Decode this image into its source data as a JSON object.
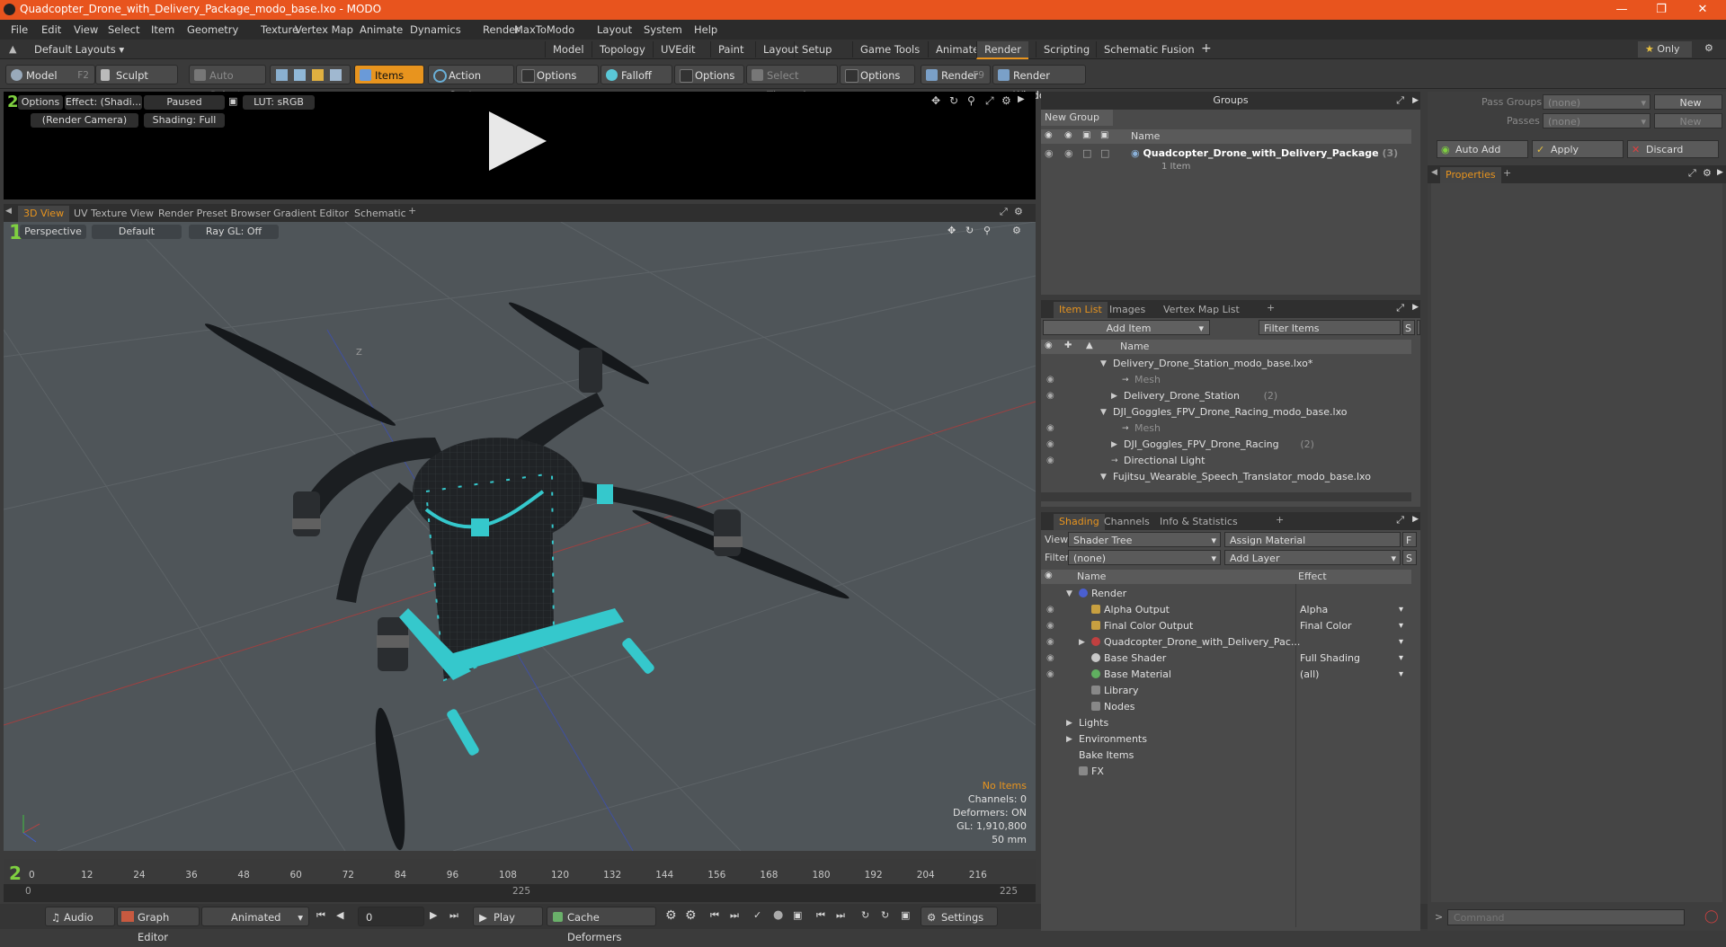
{
  "window": {
    "title": "Quadcopter_Drone_with_Delivery_Package_modo_base.lxo - MODO"
  },
  "menu": [
    "File",
    "Edit",
    "View",
    "Select",
    "Item",
    "Geometry",
    "Texture",
    "Vertex Map",
    "Animate",
    "Dynamics",
    "Render",
    "MaxToModo",
    "Layout",
    "System",
    "Help"
  ],
  "layoutbar": {
    "preset": "Default Layouts",
    "tabs": [
      "Model",
      "Topology",
      "UVEdit",
      "Paint",
      "Layout",
      "Setup",
      "Game Tools",
      "Animate",
      "Render",
      "Scripting",
      "Schematic Fusion"
    ],
    "active": "Render",
    "only": "Only"
  },
  "toolbar": {
    "model": "Model",
    "model_key": "F2",
    "sculpt": "Sculpt",
    "auto_select": "Auto Select",
    "items": "Items",
    "action_center": "Action Center",
    "options1": "Options",
    "falloff": "Falloff",
    "options2": "Options",
    "select_through": "Select Through",
    "options3": "Options",
    "render": "Render",
    "render_key": "F9",
    "render_window": "Render Window"
  },
  "preview": {
    "options": "Options",
    "effect": "Effect: (Shadi...",
    "paused": "Paused",
    "lut": "LUT: sRGB",
    "camera": "(Render Camera)",
    "shading": "Shading: Full"
  },
  "viewport_tabs": [
    "3D View",
    "UV Texture View",
    "Render Preset Browser",
    "Gradient Editor",
    "Schematic"
  ],
  "viewport": {
    "perspective": "Perspective",
    "default": "Default",
    "raygl": "Ray GL: Off",
    "axis_label": "Z",
    "stats": {
      "no_items": "No Items",
      "channels": "Channels: 0",
      "deformers": "Deformers: ON",
      "gl": "GL: 1,910,800",
      "focal": "50 mm"
    }
  },
  "timeline": {
    "ticks": [
      "0",
      "12",
      "24",
      "36",
      "48",
      "60",
      "72",
      "84",
      "96",
      "108",
      "120",
      "132",
      "144",
      "156",
      "168",
      "180",
      "192",
      "204",
      "216"
    ],
    "sub_left": "0",
    "sub_mid": "225",
    "sub_right": "225"
  },
  "bottombar": {
    "audio": "Audio",
    "graph_editor": "Graph Editor",
    "animated": "Animated",
    "frame": "0",
    "play": "Play",
    "cache": "Cache Deformers",
    "settings": "Settings"
  },
  "groups": {
    "title": "Groups",
    "new_group": "New Group",
    "col_name": "Name",
    "item_name": "Quadcopter_Drone_with_Delivery_Package",
    "item_count": "(3)",
    "item_sub": "1 Item"
  },
  "passes": {
    "pass_groups_label": "Pass Groups",
    "pass_groups_value": "(none)",
    "new1": "New",
    "passes_label": "Passes",
    "passes_value": "(none)",
    "new2": "New",
    "auto_add": "Auto Add",
    "apply": "Apply",
    "discard": "Discard",
    "properties": "Properties"
  },
  "itemlist": {
    "tabs": [
      "Item List",
      "Images",
      "Vertex Map List"
    ],
    "add_item": "Add Item",
    "filter": "Filter Items",
    "s": "S",
    "f": "F",
    "col_name": "Name",
    "rows": [
      {
        "label": "Delivery_Drone_Station_modo_base.lxo*",
        "indent": 0,
        "dim": false
      },
      {
        "label": "Mesh",
        "indent": 2,
        "dim": true
      },
      {
        "label": "Delivery_Drone_Station",
        "count": "(2)",
        "indent": 1,
        "dim": false
      },
      {
        "label": "DJI_Goggles_FPV_Drone_Racing_modo_base.lxo",
        "indent": 0,
        "dim": false
      },
      {
        "label": "Mesh",
        "indent": 2,
        "dim": true
      },
      {
        "label": "DJI_Goggles_FPV_Drone_Racing",
        "count": "(2)",
        "indent": 1,
        "dim": false
      },
      {
        "label": "Directional Light",
        "indent": 1,
        "dim": false
      },
      {
        "label": "Fujitsu_Wearable_Speech_Translator_modo_base.lxo",
        "indent": 0,
        "dim": false
      }
    ]
  },
  "shading": {
    "tabs": [
      "Shading",
      "Channels",
      "Info & Statistics"
    ],
    "view_label": "View",
    "view_value": "Shader Tree",
    "assign": "Assign Material",
    "filter_label": "Filter",
    "filter_value": "(none)",
    "add_layer": "Add Layer",
    "f": "F",
    "s": "S",
    "col_name": "Name",
    "col_effect": "Effect",
    "rows": [
      {
        "label": "Render",
        "effect": "",
        "indent": 0,
        "color": "#4a5fd0"
      },
      {
        "label": "Alpha Output",
        "effect": "Alpha",
        "indent": 1,
        "color": "#c8a040"
      },
      {
        "label": "Final Color Output",
        "effect": "Final Color",
        "indent": 1,
        "color": "#c8a040"
      },
      {
        "label": "Quadcopter_Drone_with_Delivery_Pac...",
        "effect": "",
        "indent": 1,
        "color": "#c04040"
      },
      {
        "label": "Base Shader",
        "effect": "Full Shading",
        "indent": 1,
        "color": "#c8c8c8"
      },
      {
        "label": "Base Material",
        "effect": "(all)",
        "indent": 1,
        "color": "#60b060"
      },
      {
        "label": "Library",
        "effect": "",
        "indent": 1,
        "color": "#888"
      },
      {
        "label": "Nodes",
        "effect": "",
        "indent": 1,
        "color": "#888"
      },
      {
        "label": "Lights",
        "effect": "",
        "indent": 0,
        "color": ""
      },
      {
        "label": "Environments",
        "effect": "",
        "indent": 0,
        "color": ""
      },
      {
        "label": "Bake Items",
        "effect": "",
        "indent": 0,
        "color": ""
      },
      {
        "label": "FX",
        "effect": "",
        "indent": 0,
        "color": "#888"
      }
    ]
  },
  "command": {
    "placeholder": "Command"
  },
  "colors": {
    "accent": "#e8941e",
    "title": "#e8541e",
    "cyan": "#35c8cc"
  }
}
